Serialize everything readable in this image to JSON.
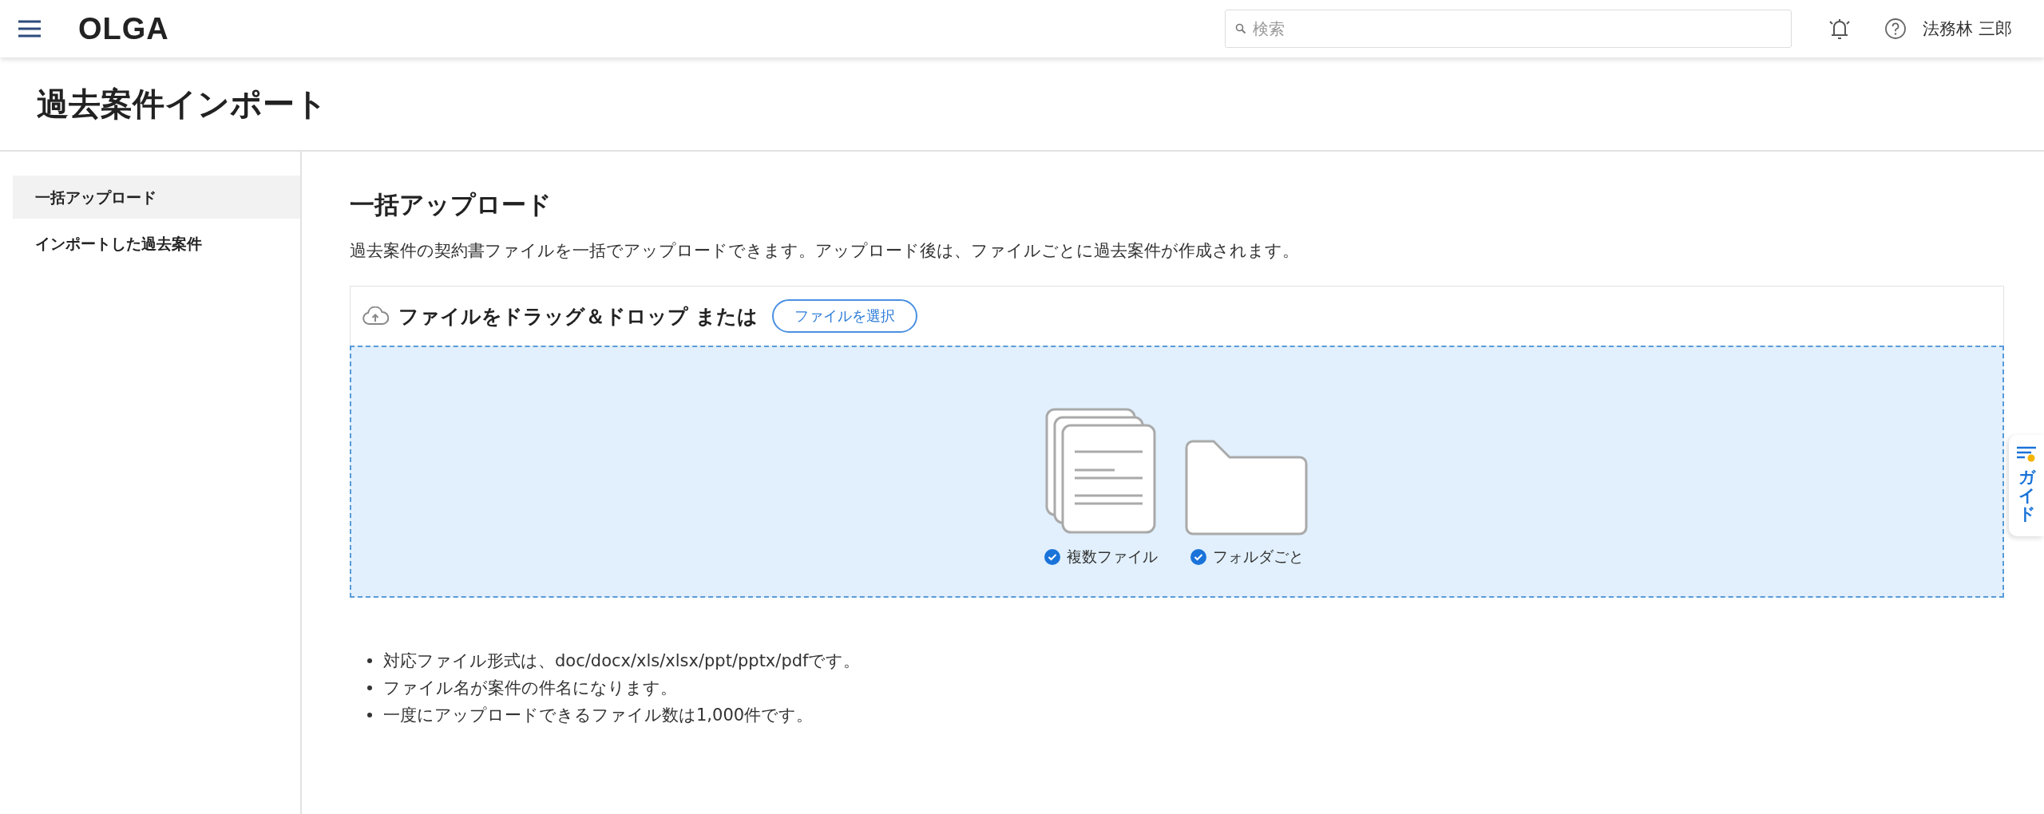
{
  "header": {
    "logo": "OLGA",
    "search": {
      "placeholder": "検索"
    },
    "user_name": "法務林 三郎"
  },
  "page_title": "過去案件インポート",
  "sidebar": {
    "items": [
      {
        "label": "一括アップロード",
        "selected": true
      },
      {
        "label": "インポートした過去案件",
        "selected": false
      }
    ]
  },
  "content": {
    "heading": "一括アップロード",
    "description": "過去案件の契約書ファイルを一括でアップロードできます。アップロード後は、ファイルごとに過去案件が作成されます。",
    "upload": {
      "prompt": "ファイルをドラッグ＆ドロップ または",
      "select_button": "ファイルを選択",
      "options": [
        {
          "kind": "files",
          "label": "複数ファイル"
        },
        {
          "kind": "folder",
          "label": "フォルダごと"
        }
      ]
    },
    "notes": [
      "対応ファイル形式は、doc/docx/xls/xlsx/ppt/pptx/pdfです。",
      "ファイル名が案件の件名になります。",
      "一度にアップロードできるファイル数は1,000件です。"
    ]
  },
  "guide_tab": {
    "label": "ガイド"
  }
}
